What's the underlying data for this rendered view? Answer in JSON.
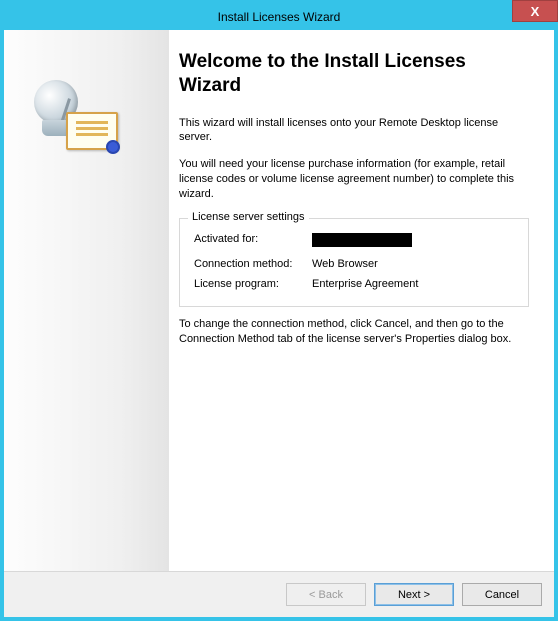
{
  "window": {
    "title": "Install Licenses Wizard",
    "close": "X"
  },
  "heading": "Welcome to the Install Licenses Wizard",
  "intro1": "This wizard will install licenses onto your Remote Desktop license server.",
  "intro2": "You will need your license purchase information (for example, retail license codes or volume license agreement number) to complete this wizard.",
  "settings": {
    "legend": "License server settings",
    "activated_label": "Activated for:",
    "activated_value": "██████████",
    "connection_label": "Connection method:",
    "connection_value": "Web Browser",
    "program_label": "License program:",
    "program_value": "Enterprise Agreement"
  },
  "note": "To change the connection method, click Cancel, and then go to the Connection Method tab of the license server's Properties dialog box.",
  "buttons": {
    "back": "< Back",
    "next": "Next >",
    "cancel": "Cancel"
  }
}
